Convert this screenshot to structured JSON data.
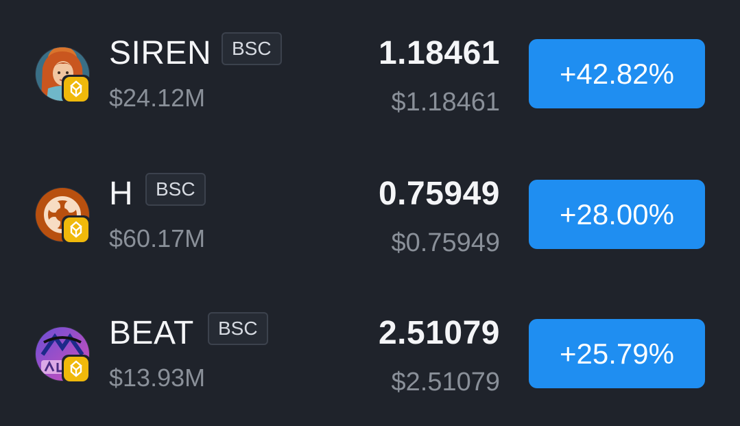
{
  "tokens": [
    {
      "symbol": "SIREN",
      "chain": "BSC",
      "market_cap": "$24.12M",
      "price": "1.18461",
      "price_usd": "$1.18461",
      "change": "+42.82%",
      "avatar_icon": "siren-token-avatar-icon",
      "chain_icon": "bnb-chain-icon"
    },
    {
      "symbol": "H",
      "chain": "BSC",
      "market_cap": "$60.17M",
      "price": "0.75949",
      "price_usd": "$0.75949",
      "change": "+28.00%",
      "avatar_icon": "h-token-avatar-icon",
      "chain_icon": "bnb-chain-icon"
    },
    {
      "symbol": "BEAT",
      "chain": "BSC",
      "market_cap": "$13.93M",
      "price": "2.51079",
      "price_usd": "$2.51079",
      "change": "+25.79%",
      "avatar_icon": "beat-token-avatar-icon",
      "chain_icon": "bnb-chain-icon"
    }
  ],
  "colors": {
    "background": "#1f232b",
    "positive_change": "#1f8ef1",
    "bnb_yellow": "#f0b90b",
    "muted_text": "#8a9099"
  }
}
